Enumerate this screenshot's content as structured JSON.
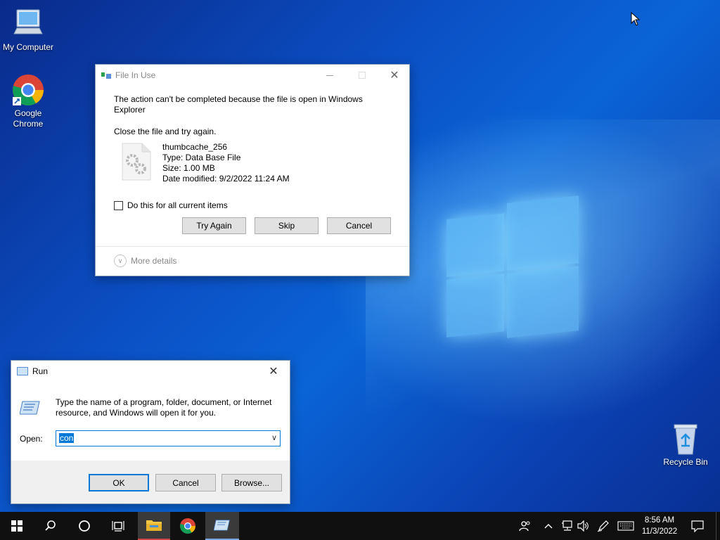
{
  "desktop": {
    "icons": [
      {
        "label": "My Computer",
        "icon": "computer-icon"
      },
      {
        "label": "Google Chrome",
        "icon": "chrome-icon"
      },
      {
        "label": "Recycle Bin",
        "icon": "recycle-bin-icon"
      }
    ]
  },
  "file_in_use": {
    "title": "File In Use",
    "message": "The action can't be completed because the file is open in Windows Explorer",
    "instruction": "Close the file and try again.",
    "file": {
      "name": "thumbcache_256",
      "type": "Type: Data Base File",
      "size": "Size: 1.00 MB",
      "modified": "Date modified: 9/2/2022 11:24 AM"
    },
    "checkbox_label": "Do this for all current items",
    "buttons": {
      "try_again": "Try Again",
      "skip": "Skip",
      "cancel": "Cancel"
    },
    "more_details": "More details"
  },
  "run": {
    "title": "Run",
    "description": "Type the name of a program, folder, document, or Internet resource, and Windows will open it for you.",
    "open_label": "Open:",
    "open_value": "con",
    "buttons": {
      "ok": "OK",
      "cancel": "Cancel",
      "browse": "Browse..."
    }
  },
  "taskbar": {
    "clock_time": "8:56 AM",
    "clock_date": "11/3/2022",
    "colors": {
      "background": "#101010",
      "active_item": "#3a3a3a",
      "accent": "#0078d7"
    }
  }
}
